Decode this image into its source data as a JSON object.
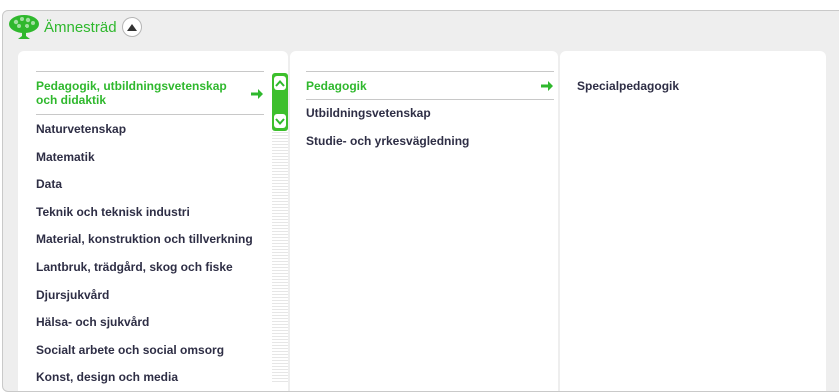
{
  "header": {
    "title": "Ämnesträd",
    "tree_icon": "tree-icon",
    "collapse_icon": "collapse-up-icon"
  },
  "column1": {
    "items": [
      {
        "label": "Pedagogik, utbildningsvetenskap och didaktik",
        "selected": true
      },
      {
        "label": "Naturvetenskap"
      },
      {
        "label": "Matematik"
      },
      {
        "label": "Data"
      },
      {
        "label": "Teknik och teknisk industri"
      },
      {
        "label": "Material, konstruktion och tillverkning"
      },
      {
        "label": "Lantbruk, trädgård, skog och fiske"
      },
      {
        "label": "Djursjukvård"
      },
      {
        "label": "Hälsa- och sjukvård"
      },
      {
        "label": "Socialt arbete och social omsorg"
      },
      {
        "label": "Konst, design och media"
      }
    ]
  },
  "column2": {
    "items": [
      {
        "label": "Pedagogik",
        "selected": true
      },
      {
        "label": "Utbildningsvetenskap"
      },
      {
        "label": "Studie- och yrkesvägledning"
      }
    ]
  },
  "column3": {
    "items": [
      {
        "label": "Specialpedagogik"
      }
    ]
  },
  "colors": {
    "accent": "#2fb82d",
    "text": "#2e2e45",
    "panel": "#eeeeee"
  }
}
